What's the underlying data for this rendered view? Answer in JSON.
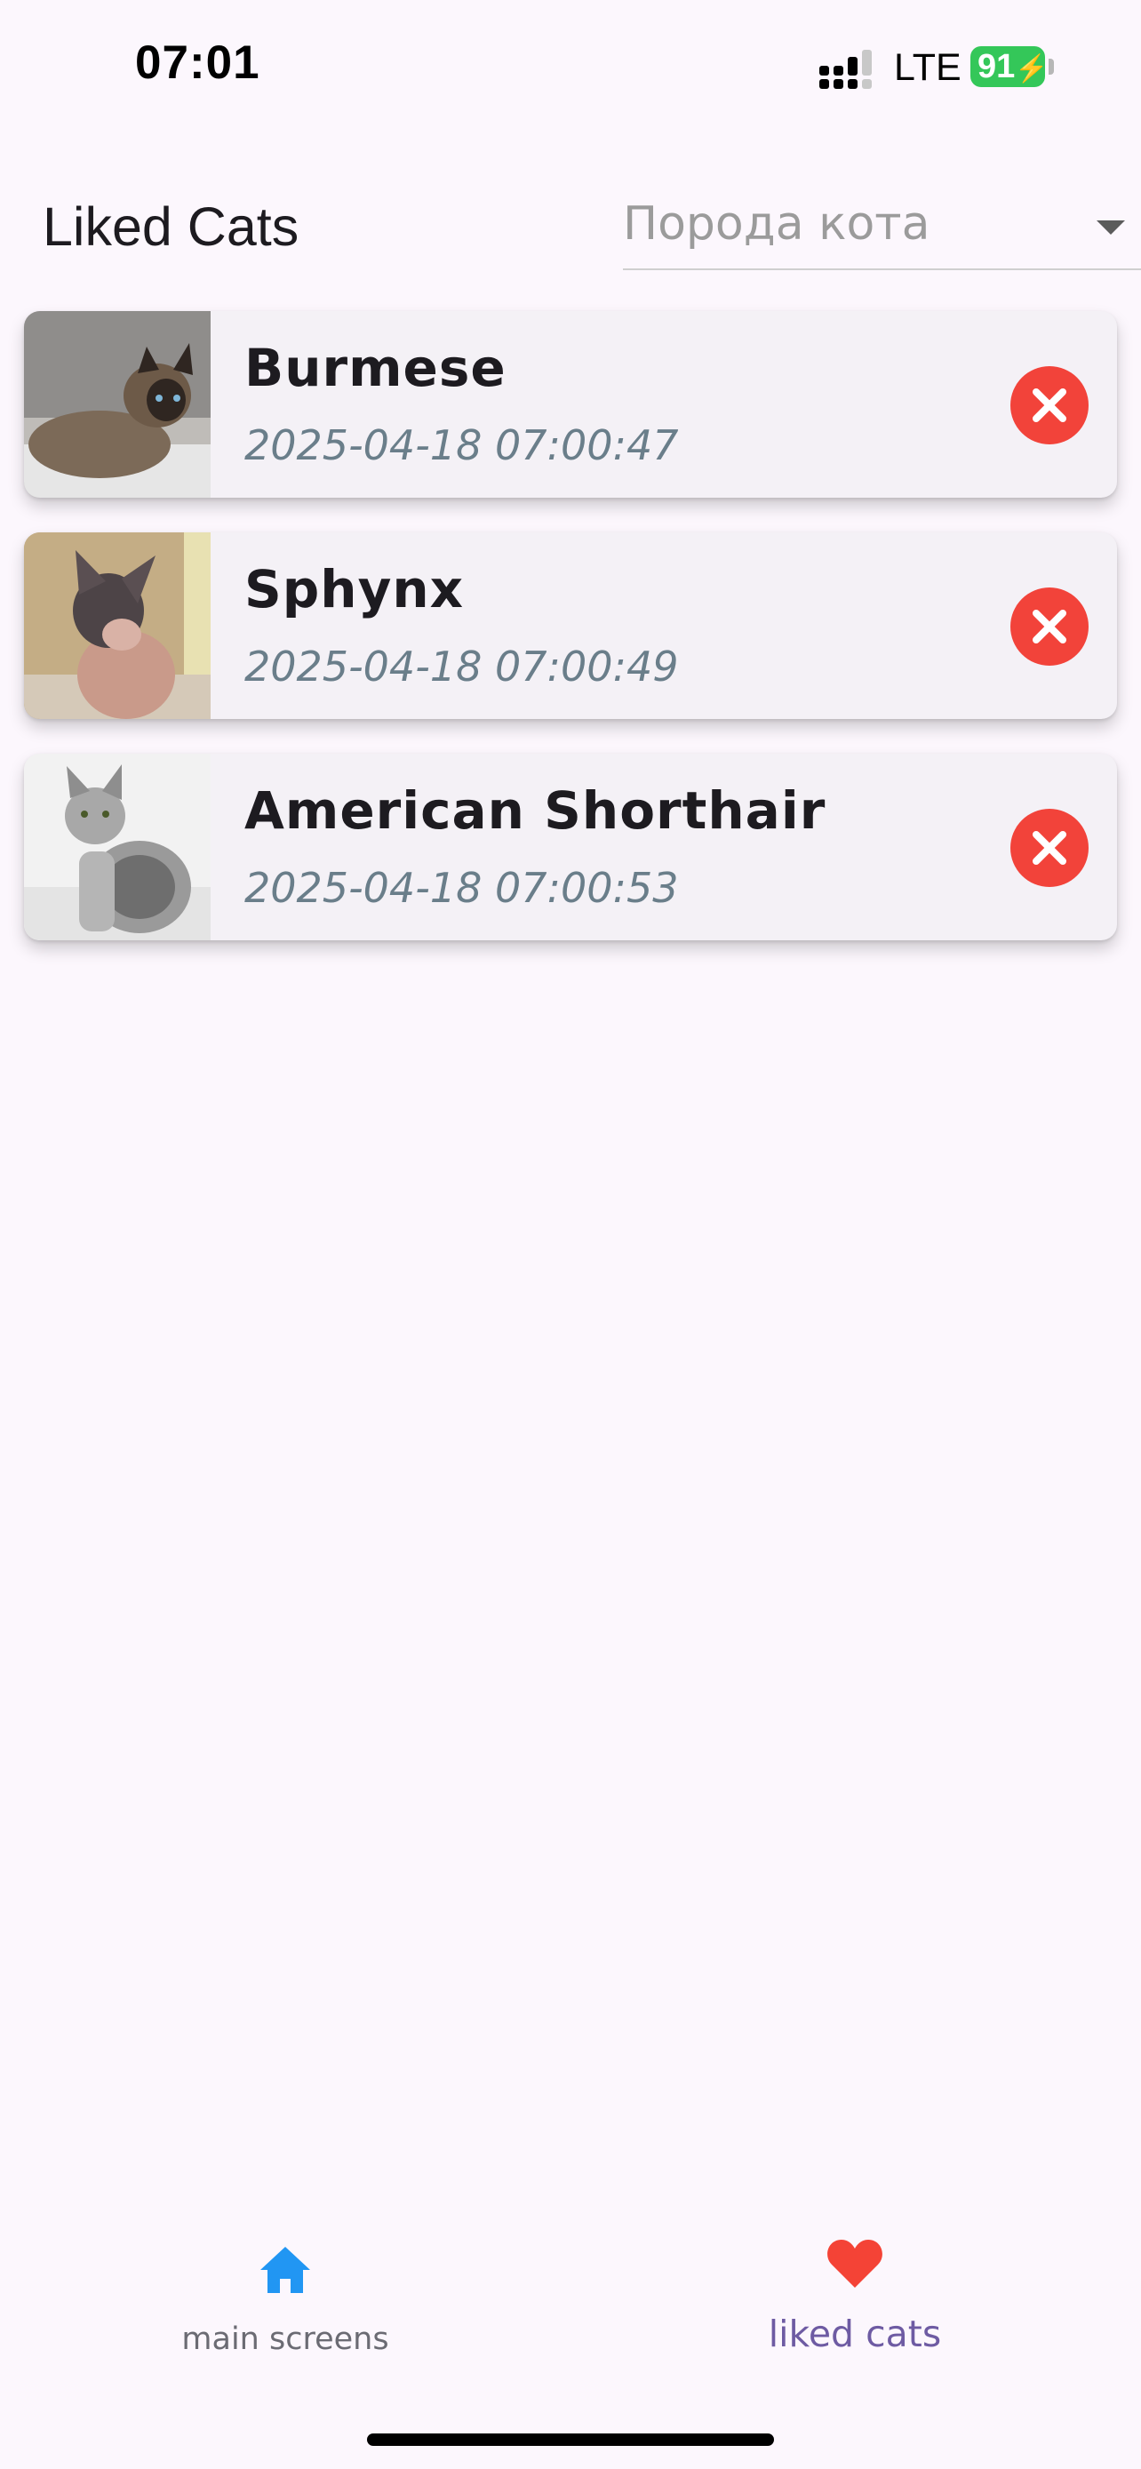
{
  "status_bar": {
    "time": "07:01",
    "network": "LTE",
    "battery": "91",
    "battery_color": "#34c759"
  },
  "header": {
    "title": "Liked Cats",
    "breed_select": {
      "placeholder": "Порода кота",
      "caret_icon": "dropdown-caret-icon"
    }
  },
  "liked_cats": [
    {
      "breed": "Burmese",
      "liked_at": "2025-04-18 07:00:47",
      "thumbnail": "burmese-cat-photo",
      "remove_icon": "cancel-circle-icon"
    },
    {
      "breed": "Sphynx",
      "liked_at": "2025-04-18 07:00:49",
      "thumbnail": "sphynx-cat-photo",
      "remove_icon": "cancel-circle-icon"
    },
    {
      "breed": "American Shorthair",
      "liked_at": "2025-04-18 07:00:53",
      "thumbnail": "american-shorthair-cat-photo",
      "remove_icon": "cancel-circle-icon"
    }
  ],
  "bottom_nav": {
    "items": [
      {
        "label": "main screens",
        "icon": "home-icon",
        "icon_color": "#2196f3",
        "selected": false
      },
      {
        "label": "liked cats",
        "icon": "heart-icon",
        "icon_color": "#f44336",
        "selected": true
      }
    ]
  },
  "colors": {
    "background": "#fcf7fd",
    "card": "#f4f1f6",
    "remove_button": "#f2433a",
    "timestamp": "#6a7e8a"
  }
}
